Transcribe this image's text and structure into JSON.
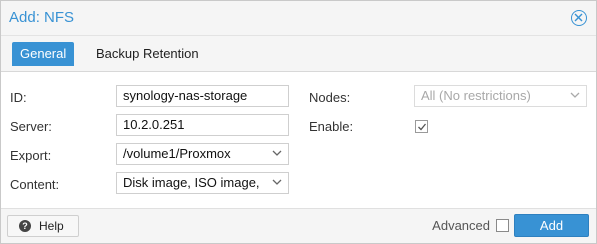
{
  "dialog": {
    "title": "Add: NFS"
  },
  "tabs": [
    {
      "label": "General",
      "active": true
    },
    {
      "label": "Backup Retention",
      "active": false
    }
  ],
  "form": {
    "id": {
      "label": "ID:",
      "value": "synology-nas-storage"
    },
    "server": {
      "label": "Server:",
      "value": "10.2.0.251"
    },
    "export": {
      "label": "Export:",
      "value": "/volume1/Proxmox"
    },
    "content": {
      "label": "Content:",
      "value": "Disk image, ISO image,"
    },
    "nodes": {
      "label": "Nodes:",
      "value": "All (No restrictions)"
    },
    "enable": {
      "label": "Enable:",
      "checked": true
    }
  },
  "footer": {
    "help_label": "Help",
    "advanced_label": "Advanced",
    "advanced_checked": false,
    "add_label": "Add"
  },
  "colors": {
    "accent": "#3892d4"
  }
}
